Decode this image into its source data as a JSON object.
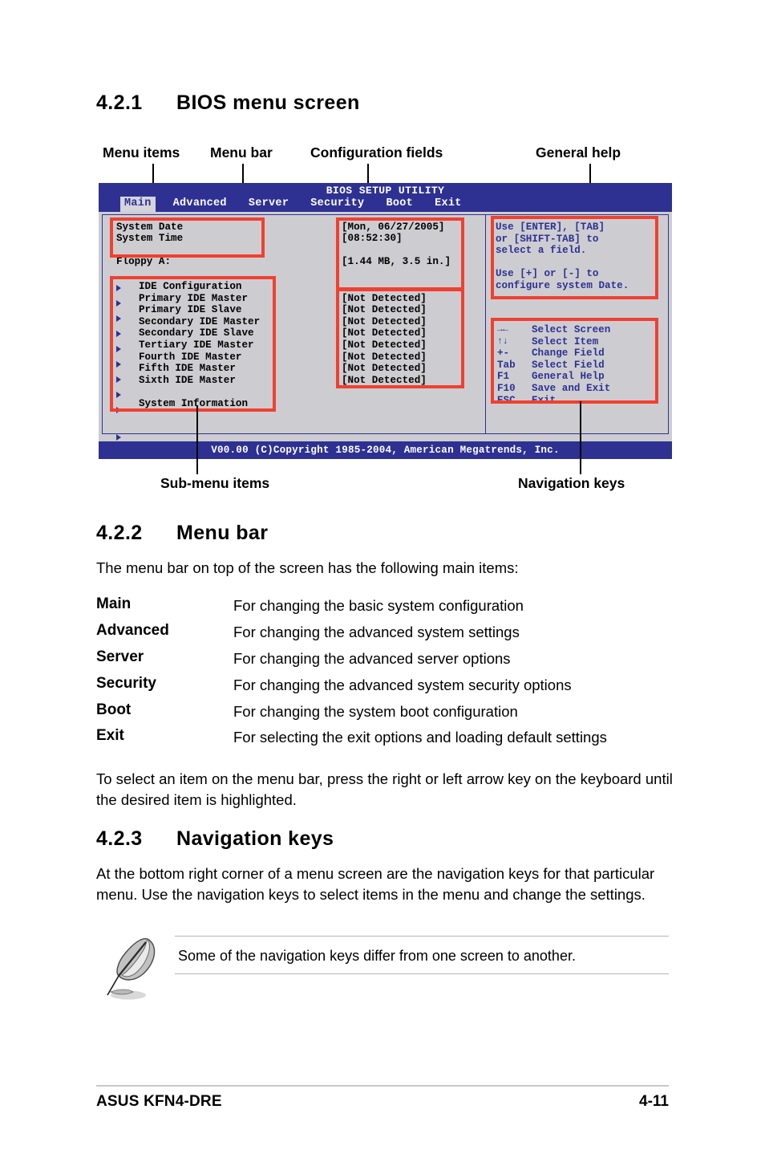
{
  "sections": {
    "s421": {
      "num": "4.2.1",
      "title": "BIOS menu screen"
    },
    "s422": {
      "num": "4.2.2",
      "title": "Menu bar"
    },
    "s423": {
      "num": "4.2.3",
      "title": "Navigation keys"
    }
  },
  "figure_callouts": {
    "menu_items": "Menu items",
    "menu_bar": "Menu bar",
    "configuration_fields": "Configuration fields",
    "general_help": "General help",
    "sub_menu_items": "Sub-menu items",
    "navigation_keys": "Navigation keys"
  },
  "bios": {
    "title": "BIOS SETUP UTILITY",
    "menu_tabs": [
      {
        "label": "Main",
        "active": true
      },
      {
        "label": "Advanced",
        "active": false
      },
      {
        "label": "Server",
        "active": false
      },
      {
        "label": "Security",
        "active": false
      },
      {
        "label": "Boot",
        "active": false
      },
      {
        "label": "Exit",
        "active": false
      }
    ],
    "menu_items_top": [
      "System Date",
      "System Time",
      "",
      "Floppy A:"
    ],
    "config_fields_top": [
      "[Mon, 06/27/2005]",
      "[08:52:30]",
      "",
      "[1.44 MB, 3.5 in.]"
    ],
    "submenu_items": [
      "IDE Configuration",
      "Primary IDE Master",
      "Primary IDE Slave",
      "Secondary IDE Master",
      "Secondary IDE Slave",
      "Tertiary IDE Master",
      "Fourth IDE Master",
      "Fifth IDE Master",
      "Sixth IDE Master"
    ],
    "submenu_last": "System Information",
    "submenu_values": [
      "[Not Detected]",
      "[Not Detected]",
      "[Not Detected]",
      "[Not Detected]",
      "[Not Detected]",
      "[Not Detected]",
      "[Not Detected]",
      "[Not Detected]"
    ],
    "general_help": "Use [ENTER], [TAB]\nor [SHIFT-TAB] to\nselect a field.\n\nUse [+] or [-] to\nconfigure system Date.",
    "nav_keys": [
      {
        "key": "→←",
        "action": "Select Screen"
      },
      {
        "key": "↑↓",
        "action": "Select Item"
      },
      {
        "key": "+-",
        "action": "Change Field"
      },
      {
        "key": "Tab",
        "action": "Select Field"
      },
      {
        "key": "F1",
        "action": "General Help"
      },
      {
        "key": "F10",
        "action": "Save and Exit"
      },
      {
        "key": "ESC",
        "action": "Exit"
      }
    ],
    "copyright": "V00.00 (C)Copyright 1985-2004, American Megatrends, Inc."
  },
  "menu_bar_section": {
    "intro": "The menu bar on top of the screen has the following main items:",
    "items": [
      {
        "term": "Main",
        "desc": "For changing the basic system configuration"
      },
      {
        "term": "Advanced",
        "desc": "For changing the advanced system settings"
      },
      {
        "term": "Server",
        "desc": "For changing the advanced server options"
      },
      {
        "term": "Security",
        "desc": "For changing the advanced system security options"
      },
      {
        "term": "Boot",
        "desc": "For changing the system boot configuration"
      },
      {
        "term": "Exit",
        "desc": "For selecting the exit options and loading default settings"
      }
    ],
    "outro": "To select an item on the menu bar, press the right or left arrow key on the keyboard until the desired item is highlighted."
  },
  "navigation_keys_section": {
    "body": "At the bottom right corner of a menu screen are the navigation keys for that particular menu. Use the navigation keys to select items in the menu and change the settings.",
    "note": "Some of the navigation keys differ from one screen to another."
  },
  "footer": {
    "left": "ASUS KFN4-DRE",
    "page": "4-11"
  },
  "colors": {
    "bios_blue": "#2e3192",
    "bios_gray": "#cdcdd1",
    "highlight_red": "#f04030",
    "tab_active_bg": "#d4d4dc"
  }
}
